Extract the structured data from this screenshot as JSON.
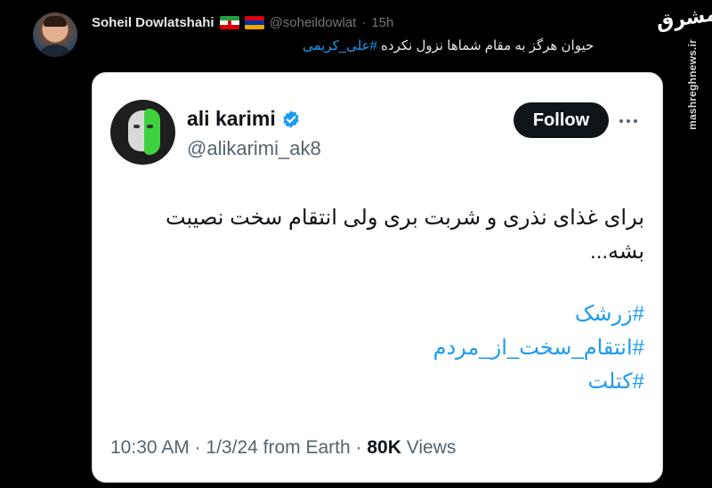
{
  "outer_tweet": {
    "name": "Soheil Dowlatshahi",
    "handle": "@soheildowlat",
    "separator": "·",
    "time": "15h",
    "text_prefix": "حیوان هرگز به مقام شماها نزول نکرده ",
    "hashtag": "#علی_کریمی",
    "flags": [
      "iran-flag",
      "armenia-flag"
    ]
  },
  "watermark": {
    "logo_text": "مشرق",
    "url": "mashreghnews.ir"
  },
  "quoted_tweet": {
    "name": "ali karimi",
    "handle": "@alikarimi_ak8",
    "follow_label": "Follow",
    "body_lines": [
      "برای غذای نذری و شربت بری ولی انتقام سخت نصیبت",
      "بشه..."
    ],
    "hashtags": [
      "#زرشک",
      "#انتقام_سخت_از_مردم",
      "#کتلت"
    ],
    "time": "10:30 AM",
    "date": "1/3/24 from Earth",
    "views_count": "80K",
    "views_label": "Views",
    "sep": "·"
  },
  "colors": {
    "background": "#000000",
    "card": "#ffffff",
    "link": "#1d9bf0",
    "verified": "#1d9bf0"
  }
}
